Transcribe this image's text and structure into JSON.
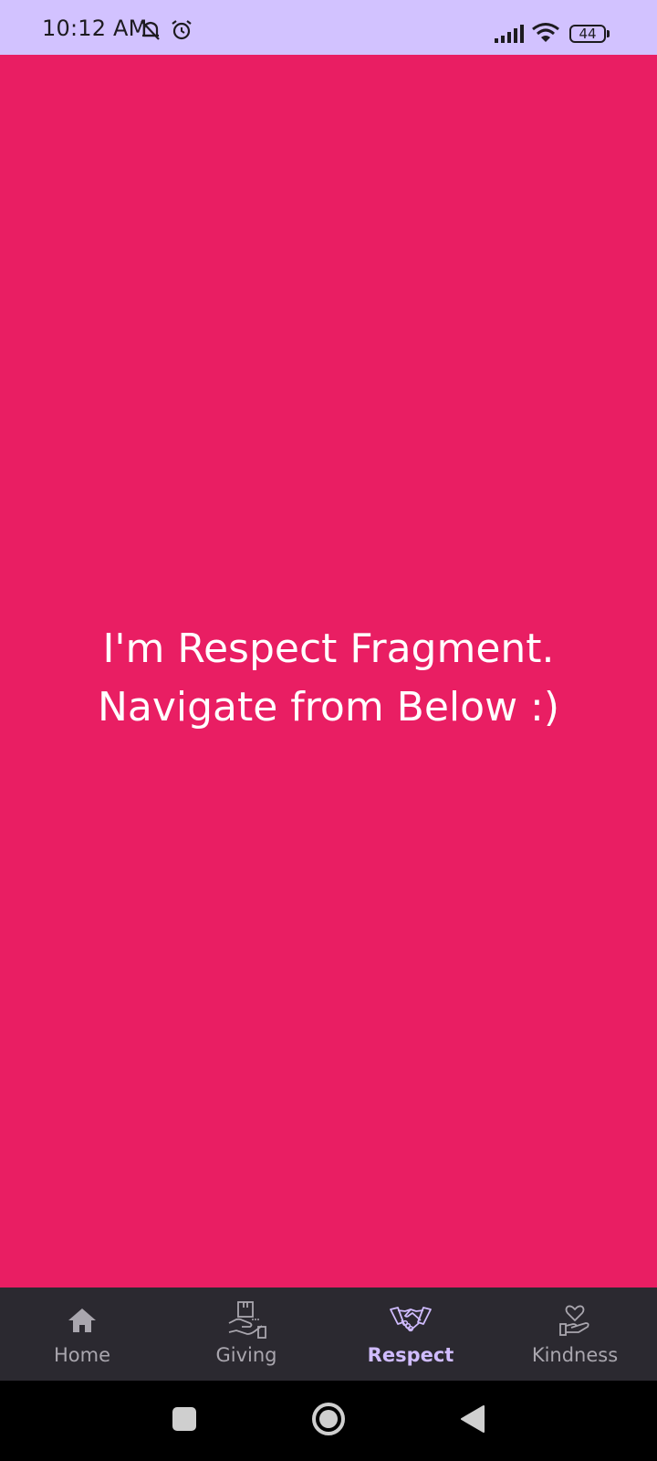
{
  "status_bar": {
    "time": "10:12 AM",
    "battery_level": "44",
    "icons": [
      "muted-bell-icon",
      "alarm-icon",
      "signal-icon",
      "wifi-icon",
      "battery-icon"
    ]
  },
  "content": {
    "message": "I'm Respect Fragment.\nNavigate from Below :)",
    "background_color": "#e91e63"
  },
  "bottom_nav": {
    "items": [
      {
        "label": "Home",
        "icon": "home-icon",
        "active": false
      },
      {
        "label": "Giving",
        "icon": "giving-box-hand-icon",
        "active": false
      },
      {
        "label": "Respect",
        "icon": "handshake-icon",
        "active": true
      },
      {
        "label": "Kindness",
        "icon": "heart-hand-icon",
        "active": false
      }
    ],
    "active_color": "#d0bcff",
    "inactive_color": "#a9a6ae",
    "background_color": "#2b2930"
  },
  "system_nav": {
    "buttons": [
      "recents-button",
      "home-button",
      "back-button"
    ]
  }
}
